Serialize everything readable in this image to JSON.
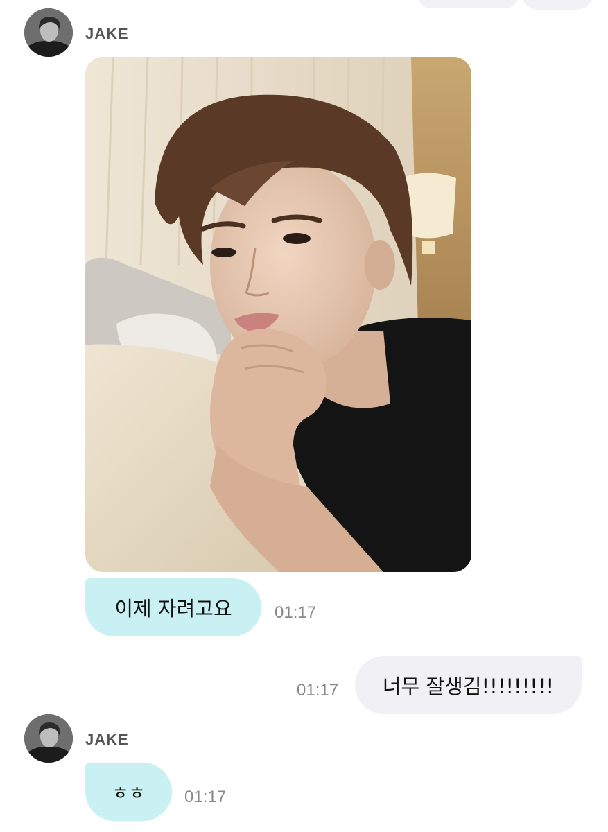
{
  "messages": [
    {
      "sender": "JAKE",
      "attachment": "selfie-photo"
    },
    {
      "sender": "JAKE",
      "text": "이제 자려고요",
      "time": "01:17"
    },
    {
      "sender": "me",
      "text": "너무 잘생김!!!!!!!!!",
      "time": "01:17"
    },
    {
      "sender": "JAKE",
      "text": "ㅎㅎ",
      "time": "01:17"
    }
  ],
  "colors": {
    "incoming_bubble": "#c9f0f2",
    "outgoing_bubble": "#f1f1f5",
    "timestamp": "#888888",
    "sender_name": "#555555"
  }
}
